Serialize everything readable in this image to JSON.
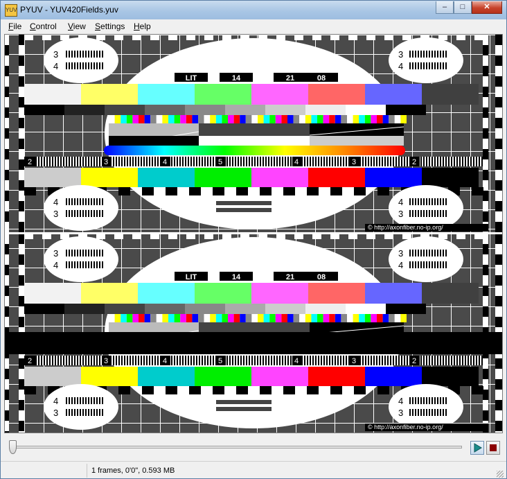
{
  "window": {
    "title": "PYUV - YUV420Fields.yuv",
    "app_icon_text": "YUV",
    "caption_buttons": {
      "minimize": "–",
      "maximize": "□",
      "close": "✕"
    }
  },
  "menubar": {
    "items": [
      {
        "label": "File",
        "underline": "F",
        "rest": "ile"
      },
      {
        "label": "Control",
        "underline": "C",
        "rest": "ontrol"
      },
      {
        "label": "View",
        "underline": "V",
        "rest": "iew"
      },
      {
        "label": "Settings",
        "underline": "S",
        "rest": "ettings"
      },
      {
        "label": "Help",
        "underline": "H",
        "rest": "elp"
      }
    ]
  },
  "video": {
    "header_labels": [
      "LIT",
      "14",
      "21",
      "08"
    ],
    "circle_numbers_top": [
      "3",
      "4"
    ],
    "circle_numbers_bottom": [
      "4",
      "3"
    ],
    "scale_numbers": [
      "2",
      "3",
      "4",
      "5",
      "4",
      "3",
      "2"
    ],
    "watermark": "© http://axonfiber.no-ip.org/",
    "colors": {
      "upper_bars": [
        "#f2f2f2",
        "#ffff66",
        "#66ffff",
        "#66ff66",
        "#ff66ff",
        "#ff6666",
        "#6666ff",
        "#404040"
      ],
      "lower_bars": [
        "#cccccc",
        "#ffff00",
        "#00cccc",
        "#00ee00",
        "#ff44ff",
        "#ff0000",
        "#0000ff",
        "#000000"
      ],
      "grey_ramp": [
        "#000000",
        "#222222",
        "#444444",
        "#666666",
        "#888888",
        "#aaaaaa",
        "#cccccc",
        "#eeeeee",
        "#ffffff",
        "#000000"
      ]
    }
  },
  "playback": {
    "position_fraction": 0.0,
    "play_icon": "play-icon",
    "stop_icon": "stop-icon"
  },
  "status": {
    "text": "1 frames, 0'0\", 0.593 MB"
  }
}
